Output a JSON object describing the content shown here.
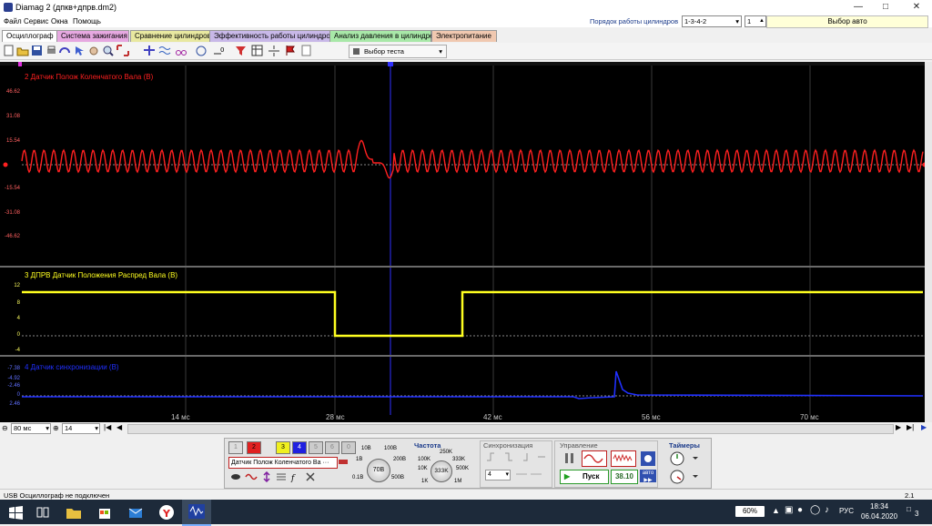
{
  "window": {
    "title": "Diamag 2 (дпкв+дпрв.dm2)"
  },
  "menu": [
    "Файл",
    "Сервис",
    "Окна",
    "Помощь"
  ],
  "cylinder_order": {
    "label": "Порядок работы цилиндров",
    "value": "1-3-4-2",
    "cyl_num": "1",
    "auto_label": "Выбор авто"
  },
  "tabs": [
    {
      "label": "Осциллограф",
      "color": "#ffffff"
    },
    {
      "label": "Система зажигания",
      "color": "#e6a8e0"
    },
    {
      "label": "Сравнение цилиндров",
      "color": "#e8e8a0"
    },
    {
      "label": "Эффективность работы цилиндров",
      "color": "#c8b8e8"
    },
    {
      "label": "Анализ давления в цилиндре",
      "color": "#a8e8a8"
    },
    {
      "label": "Электропитание",
      "color": "#f0c8b0"
    }
  ],
  "toolbar": {
    "test_select": "Выбор теста"
  },
  "channels": {
    "ch2": {
      "title": "2 Датчик Полож Коленчатого Вала (В)",
      "color": "#ff2020",
      "ticks": [
        "46.62",
        "31.08",
        "15.54",
        "0",
        "-15.54",
        "-31.08",
        "-46.62"
      ]
    },
    "ch3": {
      "title": "3 ДПРВ Датчик Положения Распред Вала (В)",
      "color": "#ffff20",
      "ticks": [
        "12",
        "8",
        "4",
        "0",
        "-4"
      ]
    },
    "ch4": {
      "title": "4 Датчик синхронизации (В)",
      "color": "#2020ff",
      "ticks": [
        "-7.38",
        "-4.92",
        "-2.46",
        "0",
        "2.46"
      ]
    }
  },
  "xaxis": {
    "labels": [
      "14 мс",
      "28 мс",
      "42 мс",
      "56 мс",
      "70 мс"
    ]
  },
  "timebase": {
    "value": "80 мс",
    "zoom": "14"
  },
  "channel_buttons": [
    "1",
    "2",
    "3",
    "4",
    "5",
    "6",
    "0"
  ],
  "channel_select": "Датчик Полож Коленчатого Ва",
  "voltage_knob": {
    "labels": [
      "10В",
      "100В",
      "1В",
      "200В",
      "0.1В",
      "500В"
    ],
    "value": "70В"
  },
  "frequency": {
    "title": "Частота",
    "labels": [
      "250K",
      "100K",
      "333K",
      "10K",
      "500K",
      "1K",
      "1M"
    ],
    "value": "333K"
  },
  "sync": {
    "title": "Синхронизация",
    "value": "4"
  },
  "control": {
    "title": "Управление",
    "start_label": "Пуск",
    "value": "38.10",
    "auto_label": "авто"
  },
  "timers": {
    "title": "Таймеры"
  },
  "status": {
    "text": "USB Осциллограф не подключен",
    "version": "2.1"
  },
  "taskbar": {
    "battery": "60%",
    "lang": "РУС",
    "time": "18:34",
    "date": "06.04.2020",
    "notif": "3"
  }
}
